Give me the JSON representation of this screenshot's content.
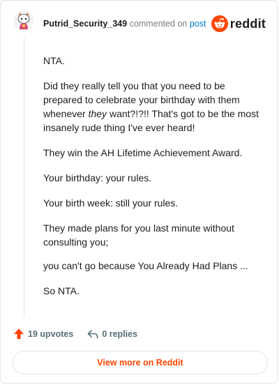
{
  "header": {
    "username": "Putrid_Security_349",
    "commented_text": "commented on",
    "post_link": "post",
    "brand": "reddit"
  },
  "comment": {
    "paragraphs": [
      "NTA.",
      "",
      "Your birthday: your rules.",
      "Your birth week: still your rules.",
      "They made plans for you last minute without consulting you;",
      "you can't go because You Already Had Plans ...",
      "So NTA."
    ],
    "p2_before": "Did they really tell you that you need to be prepared to celebrate your birthday with them whenever ",
    "p2_em": "they",
    "p2_after": " want?!?!! That's got to be the most insanely rude thing I've ever heard!",
    "p3": "They win the AH Lifetime Achievement Award."
  },
  "footer": {
    "upvotes": "19 upvotes",
    "replies": "0 replies",
    "view_more": "View more on Reddit"
  },
  "colors": {
    "reddit_orange": "#ff4500",
    "link_blue": "#0079d3",
    "meta_gray": "#576f76"
  },
  "icons": {
    "avatar": "snoo-avatar-icon",
    "brand": "reddit-logo-icon",
    "upvote": "upvote-arrow-icon",
    "reply": "reply-arrow-icon"
  }
}
